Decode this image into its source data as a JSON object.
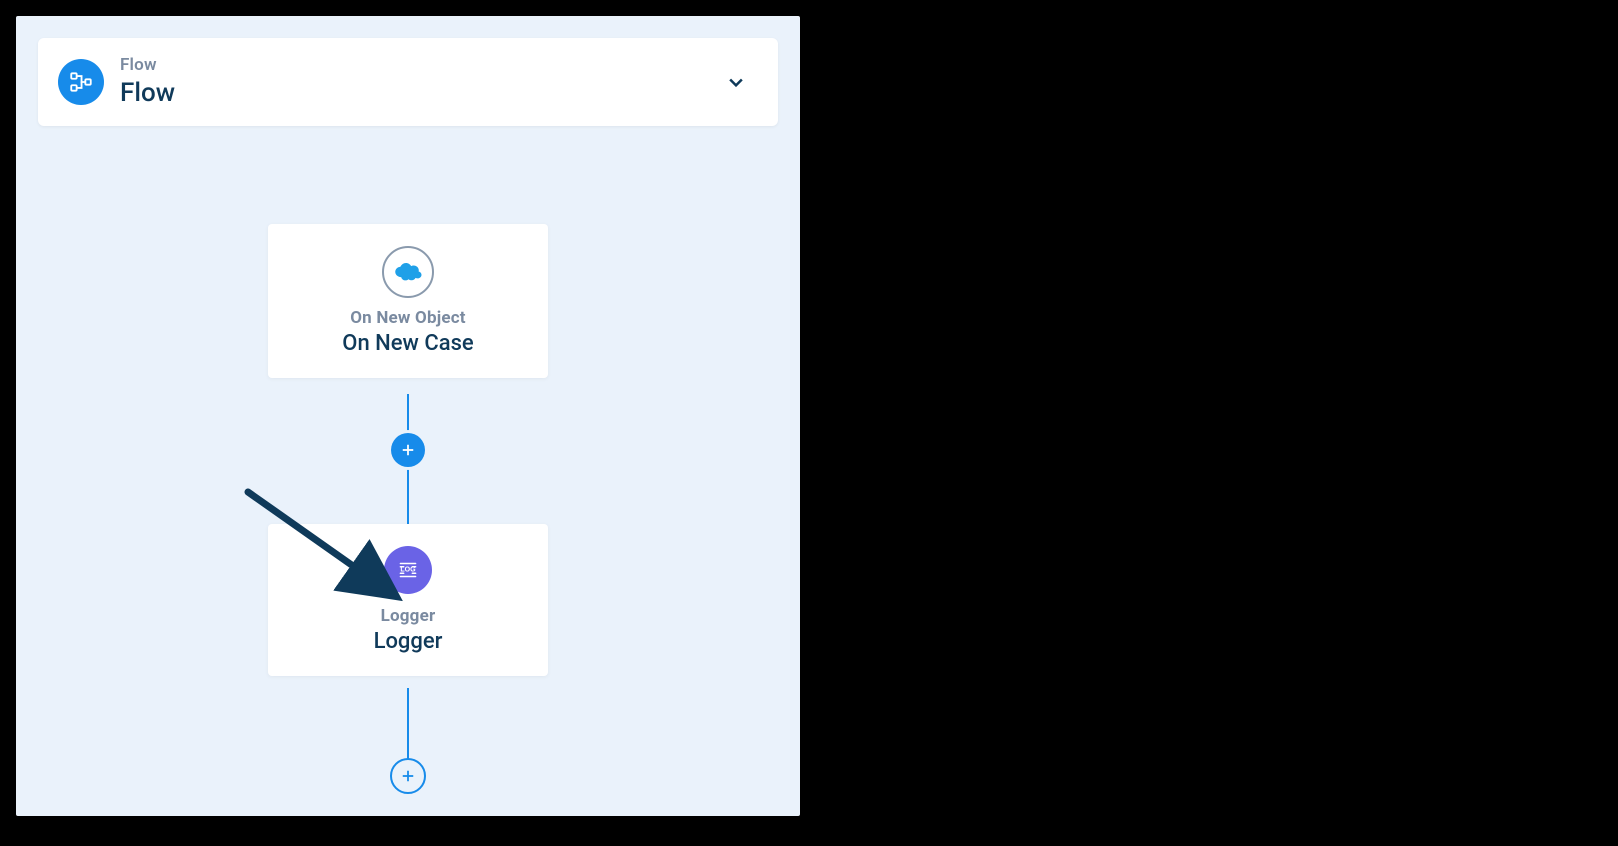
{
  "header": {
    "kicker": "Flow",
    "title": "Flow",
    "icon": "flow-icon"
  },
  "nodes": [
    {
      "id": "n1",
      "icon": "salesforce-cloud-icon",
      "kicker": "On New Object",
      "title": "On New Case"
    },
    {
      "id": "n2",
      "icon": "logger-icon",
      "kicker": "Logger",
      "title": "Logger"
    }
  ],
  "annotations": {
    "arrow_target": "add-step-between-n1-n2"
  },
  "colors": {
    "panel_bg": "#eaf2fb",
    "accent": "#178bea",
    "node_kicker": "#7a8aa0",
    "node_title": "#103a5a",
    "logger_icon_bg": "#6a63e6",
    "arrow": "#0f3a5a"
  }
}
